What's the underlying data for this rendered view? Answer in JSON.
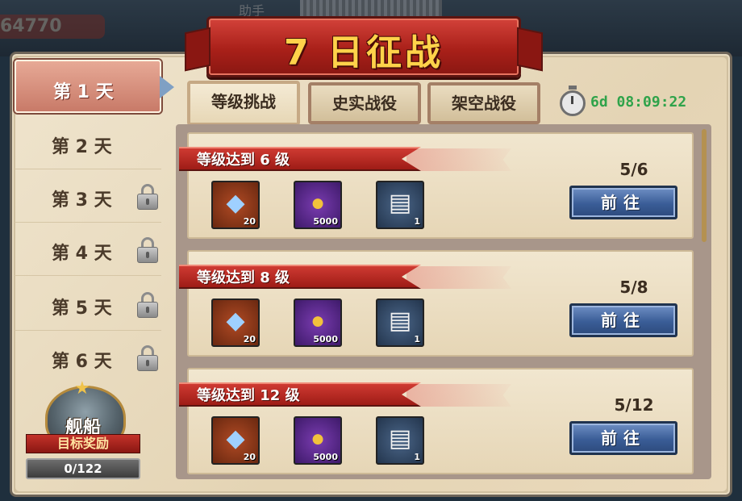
{
  "background": {
    "score": "64770",
    "name": "助手"
  },
  "title": "7 日征战",
  "days": [
    {
      "label": "第 1 天",
      "active": true,
      "locked": false
    },
    {
      "label": "第 2 天",
      "active": false,
      "locked": false
    },
    {
      "label": "第 3 天",
      "active": false,
      "locked": true
    },
    {
      "label": "第 4 天",
      "active": false,
      "locked": true
    },
    {
      "label": "第 5 天",
      "active": false,
      "locked": true
    },
    {
      "label": "第 6 天",
      "active": false,
      "locked": true
    }
  ],
  "ship_reward": {
    "title": "舰船",
    "subtitle": "目标奖励",
    "progress": "0/122"
  },
  "tabs": [
    {
      "label": "等级挑战",
      "active": true
    },
    {
      "label": "史实战役",
      "active": false
    },
    {
      "label": "架空战役",
      "active": false
    }
  ],
  "timer": "6d 08:09:22",
  "tasks": [
    {
      "title": "等级达到 6 级",
      "progress": "5/6",
      "button": "前往",
      "rewards": [
        {
          "icon": "diamond-icon",
          "count": "20"
        },
        {
          "icon": "gold-coins-icon",
          "count": "5000"
        },
        {
          "icon": "document-icon",
          "count": "1"
        }
      ]
    },
    {
      "title": "等级达到 8 级",
      "progress": "5/8",
      "button": "前往",
      "rewards": [
        {
          "icon": "diamond-icon",
          "count": "20"
        },
        {
          "icon": "gold-coins-icon",
          "count": "5000"
        },
        {
          "icon": "document-icon",
          "count": "1"
        }
      ]
    },
    {
      "title": "等级达到 12 级",
      "progress": "5/12",
      "button": "前往",
      "rewards": [
        {
          "icon": "diamond-icon",
          "count": "20"
        },
        {
          "icon": "gold-coins-icon",
          "count": "5000"
        },
        {
          "icon": "document-icon",
          "count": "1"
        }
      ]
    }
  ]
}
